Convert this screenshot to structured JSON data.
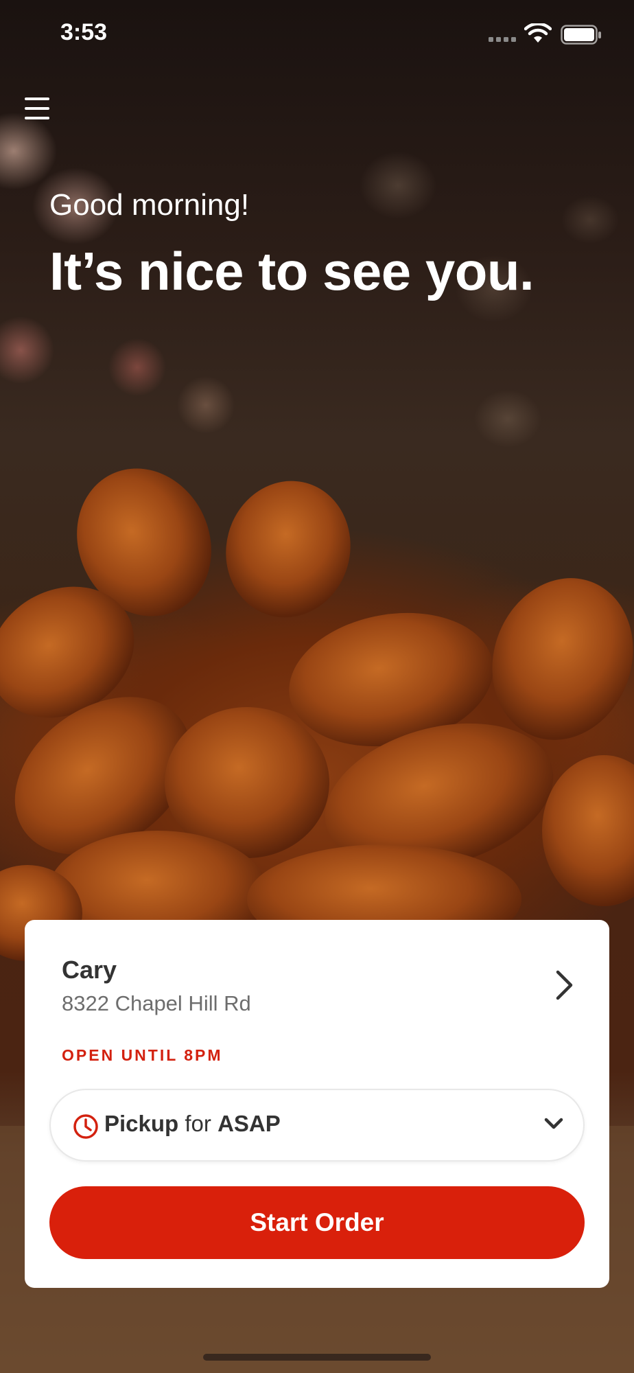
{
  "status_bar": {
    "time": "3:53"
  },
  "header": {
    "menu_icon": "hamburger-menu-icon"
  },
  "hero": {
    "greeting": "Good morning!",
    "headline": "It’s nice to see you."
  },
  "store_card": {
    "store_name": "Cary",
    "address": "8322 Chapel Hill Rd",
    "open_status": "OPEN UNTIL 8PM",
    "chevron_icon": "chevron-right-icon"
  },
  "order_options": {
    "mode_label": "Pickup",
    "connector": "for",
    "time_label": "ASAP",
    "clock_icon": "clock-icon",
    "dropdown_icon": "chevron-down-icon"
  },
  "start_order": {
    "label": "Start Order"
  },
  "colors": {
    "accent": "#d9200b",
    "open_status": "#d3210f",
    "text_dark": "#333333",
    "text_muted": "#6d6d6d"
  }
}
